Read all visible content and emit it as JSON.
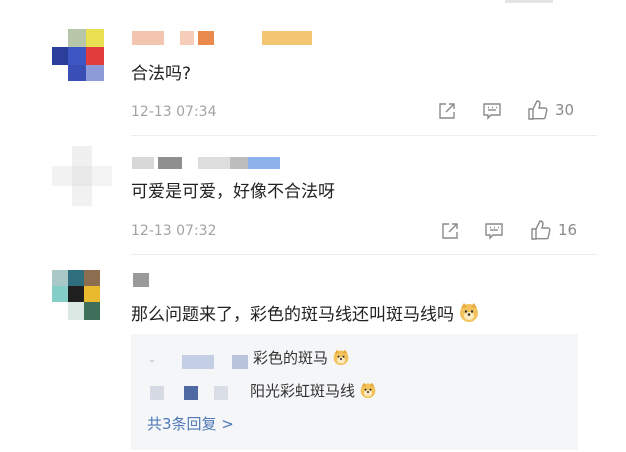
{
  "comments": [
    {
      "text": "合法吗?",
      "time": "12-13 07:34",
      "likes": "30"
    },
    {
      "text": "可爱是可爱，好像不合法呀",
      "time": "12-13 07:32",
      "likes": "16"
    },
    {
      "text": "那么问题来了，彩色的斑马线还叫斑马线吗"
    }
  ],
  "replies": [
    {
      "text": "彩色的斑马"
    },
    {
      "text": "阳光彩虹斑马线"
    }
  ],
  "more_replies": "共3条回复 >",
  "icons": {
    "share": "share-icon",
    "comment": "comment-icon",
    "like": "thumbs-up-icon",
    "emoji": "doge-emoji-icon"
  },
  "colors": {
    "link": "#4e78b6",
    "meta": "#a3a3a3",
    "reply_bg": "#f5f6f8"
  }
}
